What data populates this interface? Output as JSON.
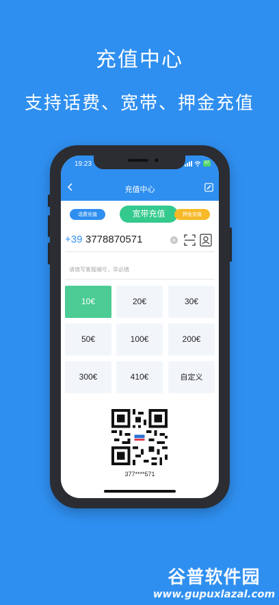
{
  "promo": {
    "headline": "充值中心",
    "subline": "支持话费、宽带、押金充值"
  },
  "status_bar": {
    "time": "19:23",
    "battery": "87"
  },
  "navbar": {
    "title": "充值中心",
    "back_icon": "chevron-left-icon",
    "edit_icon": "edit-icon"
  },
  "segments": {
    "phone_fee": "话费充值",
    "broadband": "宽带充值",
    "deposit": "押金充值",
    "selected": "broadband"
  },
  "phone_input": {
    "country_code": "+39",
    "number": "3778870571",
    "clear_icon": "clear-icon",
    "scan_icon": "scan-icon",
    "contacts_icon": "contacts-icon"
  },
  "remark_input": {
    "placeholder": "请填写客服编号，非必填"
  },
  "amounts": [
    "10€",
    "20€",
    "30€",
    "50€",
    "100€",
    "200€",
    "300€",
    "410€",
    "自定义"
  ],
  "selected_amount": "10€",
  "qr": {
    "masked_number": "377****571"
  },
  "watermark": {
    "text": "谷普软件园",
    "url": "www.gupuxlazal.com"
  },
  "colors": {
    "background": "#2f8ff0",
    "accent_green": "#34c98d",
    "selected_cell": "#4ccb95",
    "deposit_yellow": "#f7b928"
  }
}
